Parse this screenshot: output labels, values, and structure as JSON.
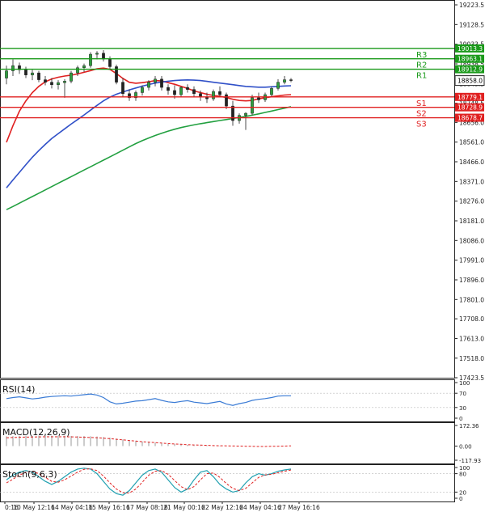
{
  "chart_data": {
    "type": "candlestick",
    "instrument_hint": "",
    "x_ticks": [
      "0:16",
      "10 May 12:16",
      "14 May 04:16",
      "15 May 16:16",
      "17 May 08:16",
      "21 May 00:16",
      "22 May 12:16",
      "24 May 04:16",
      "27 May 16:16"
    ],
    "y_ticks": [
      19223.5,
      19128.5,
      19033.5,
      18938.5,
      18843.5,
      18748.5,
      18656.0,
      18561.0,
      18466.0,
      18371.0,
      18276.0,
      18181.0,
      18086.0,
      17991.0,
      17896.0,
      17801.0,
      17708.0,
      17613.0,
      17518.0,
      17423.5
    ],
    "ylim": [
      17423.5,
      19223.5
    ],
    "current_price": "18858.0",
    "levels": [
      {
        "name": "R3",
        "value": 19013.3,
        "label": "19013.3",
        "color": "#1a9a1a"
      },
      {
        "name": "R2",
        "value": 18963.1,
        "label": "18963.1",
        "color": "#1a9a1a"
      },
      {
        "name": "R1",
        "value": 18912.9,
        "label": "18912.9",
        "color": "#1a9a1a"
      },
      {
        "name": "S1",
        "value": 18779.1,
        "label": "18779.1",
        "color": "#e02020"
      },
      {
        "name": "S2",
        "value": 18728.9,
        "label": "18728.9",
        "color": "#e02020"
      },
      {
        "name": "S3",
        "value": 18678.7,
        "label": "18678.7",
        "color": "#e02020"
      }
    ],
    "candles": [
      [
        18870,
        18930,
        18840,
        18905
      ],
      [
        18905,
        18960,
        18880,
        18930
      ],
      [
        18930,
        18945,
        18890,
        18910
      ],
      [
        18910,
        18925,
        18870,
        18885
      ],
      [
        18885,
        18910,
        18860,
        18895
      ],
      [
        18895,
        18905,
        18850,
        18862
      ],
      [
        18862,
        18880,
        18835,
        18850
      ],
      [
        18850,
        18870,
        18820,
        18838
      ],
      [
        18838,
        18860,
        18815,
        18848
      ],
      [
        18848,
        18865,
        18775,
        18855
      ],
      [
        18855,
        18905,
        18845,
        18895
      ],
      [
        18895,
        18930,
        18880,
        18920
      ],
      [
        18920,
        18940,
        18900,
        18930
      ],
      [
        18930,
        18995,
        18920,
        18985
      ],
      [
        18985,
        19000,
        18960,
        18990
      ],
      [
        18990,
        19005,
        18950,
        18962
      ],
      [
        18962,
        18975,
        18910,
        18925
      ],
      [
        18925,
        18935,
        18840,
        18850
      ],
      [
        18850,
        18870,
        18780,
        18795
      ],
      [
        18795,
        18815,
        18760,
        18775
      ],
      [
        18775,
        18810,
        18760,
        18800
      ],
      [
        18800,
        18835,
        18785,
        18825
      ],
      [
        18825,
        18860,
        18810,
        18850
      ],
      [
        18850,
        18880,
        18830,
        18865
      ],
      [
        18865,
        18880,
        18810,
        18825
      ],
      [
        18825,
        18840,
        18790,
        18810
      ],
      [
        18810,
        18835,
        18770,
        18790
      ],
      [
        18790,
        18830,
        18780,
        18825
      ],
      [
        18825,
        18840,
        18800,
        18815
      ],
      [
        18815,
        18830,
        18780,
        18795
      ],
      [
        18795,
        18810,
        18760,
        18780
      ],
      [
        18780,
        18800,
        18750,
        18770
      ],
      [
        18770,
        18815,
        18760,
        18805
      ],
      [
        18805,
        18830,
        18780,
        18790
      ],
      [
        18790,
        18800,
        18720,
        18735
      ],
      [
        18735,
        18760,
        18640,
        18665
      ],
      [
        18665,
        18700,
        18650,
        18690
      ],
      [
        18690,
        18705,
        18620,
        18700
      ],
      [
        18700,
        18790,
        18690,
        18775
      ],
      [
        18775,
        18800,
        18750,
        18765
      ],
      [
        18765,
        18800,
        18755,
        18790
      ],
      [
        18790,
        18830,
        18780,
        18820
      ],
      [
        18820,
        18865,
        18810,
        18850
      ],
      [
        18850,
        18880,
        18840,
        18862
      ],
      [
        18862,
        18870,
        18850,
        18858
      ]
    ],
    "series": [
      {
        "name": "",
        "color": "#e02020",
        "values": [
          18560,
          18640,
          18710,
          18760,
          18800,
          18830,
          18852,
          18866,
          18874,
          18880,
          18884,
          18890,
          18898,
          18906,
          18915,
          18918,
          18912,
          18892,
          18868,
          18850,
          18845,
          18848,
          18852,
          18858,
          18856,
          18848,
          18840,
          18830,
          18820,
          18808,
          18800,
          18792,
          18786,
          18782,
          18776,
          18768,
          18762,
          18760,
          18762,
          18770,
          18775,
          18780,
          18784,
          18788,
          18790
        ]
      },
      {
        "name": "",
        "color": "#3050c8",
        "values": [
          18340,
          18378,
          18415,
          18452,
          18488,
          18520,
          18550,
          18578,
          18602,
          18625,
          18648,
          18670,
          18692,
          18715,
          18738,
          18760,
          18778,
          18792,
          18803,
          18813,
          18822,
          18831,
          18839,
          18846,
          18851,
          18855,
          18858,
          18860,
          18861,
          18860,
          18858,
          18854,
          18850,
          18846,
          18842,
          18838,
          18834,
          18830,
          18828,
          18826,
          18826,
          18828,
          18830,
          18832,
          18833
        ]
      },
      {
        "name": "",
        "color": "#22a040",
        "values": [
          18235,
          18250,
          18266,
          18282,
          18298,
          18314,
          18330,
          18346,
          18362,
          18378,
          18394,
          18410,
          18426,
          18442,
          18458,
          18474,
          18490,
          18506,
          18522,
          18538,
          18554,
          18568,
          18581,
          18593,
          18604,
          18614,
          18623,
          18631,
          18638,
          18644,
          18650,
          18655,
          18660,
          18665,
          18670,
          18675,
          18680,
          18685,
          18691,
          18697,
          18704,
          18711,
          18718,
          18725,
          18732
        ]
      }
    ],
    "indicators": [
      {
        "name": "RSI(14)",
        "ticks": [
          "100",
          "70",
          "30",
          "0"
        ],
        "range": [
          0,
          100
        ],
        "color": "#3a7bd5",
        "values": [
          55,
          58,
          60,
          57,
          54,
          56,
          59,
          61,
          62,
          63,
          62,
          64,
          66,
          68,
          65,
          58,
          46,
          40,
          42,
          45,
          48,
          49,
          52,
          55,
          50,
          46,
          44,
          47,
          49,
          45,
          43,
          41,
          44,
          47,
          40,
          36,
          41,
          44,
          50,
          53,
          55,
          58,
          62,
          63,
          63
        ]
      },
      {
        "name": "MACD(12,26,9)",
        "ticks": [
          "172.36",
          "0.00",
          "-117.93"
        ],
        "range": [
          -117.93,
          172.36
        ],
        "color": "#e02020",
        "histogram": [
          82,
          84,
          85,
          86,
          86,
          87,
          87,
          87,
          86,
          86,
          85,
          84,
          84,
          82,
          80,
          76,
          70,
          63,
          56,
          50,
          44,
          38,
          33,
          28,
          24,
          20,
          16,
          13,
          10,
          8,
          6,
          5,
          4,
          3,
          2,
          1,
          0,
          -1,
          -1,
          -1,
          -1,
          0,
          0,
          1,
          1
        ],
        "signal": [
          70,
          72,
          74,
          75,
          76,
          77,
          78,
          78,
          78,
          78,
          77,
          76,
          74,
          72,
          70,
          66,
          62,
          57,
          52,
          47,
          42,
          37,
          33,
          29,
          25,
          21,
          18,
          15,
          12,
          10,
          8,
          6,
          4,
          3,
          2,
          1,
          0,
          -1,
          -2,
          -3,
          -3,
          -2,
          -1,
          0,
          2
        ]
      },
      {
        "name": "Stoch(9,6,3)",
        "ticks": [
          "100",
          "80",
          "20",
          "0"
        ],
        "range": [
          0,
          100
        ],
        "main_color": "#20a0b0",
        "signal_color": "#e02020",
        "main": [
          60,
          75,
          85,
          90,
          85,
          70,
          55,
          45,
          55,
          70,
          85,
          95,
          98,
          95,
          80,
          55,
          30,
          15,
          10,
          25,
          50,
          75,
          90,
          95,
          85,
          60,
          35,
          20,
          30,
          60,
          85,
          90,
          70,
          45,
          30,
          20,
          25,
          50,
          70,
          80,
          75,
          80,
          88,
          92,
          95
        ],
        "signal": [
          50,
          62,
          75,
          85,
          88,
          80,
          68,
          55,
          52,
          60,
          72,
          85,
          94,
          96,
          90,
          72,
          50,
          30,
          18,
          17,
          30,
          52,
          75,
          88,
          90,
          78,
          58,
          38,
          28,
          38,
          60,
          80,
          82,
          68,
          48,
          32,
          25,
          32,
          50,
          68,
          76,
          78,
          83,
          88,
          92
        ]
      }
    ]
  }
}
